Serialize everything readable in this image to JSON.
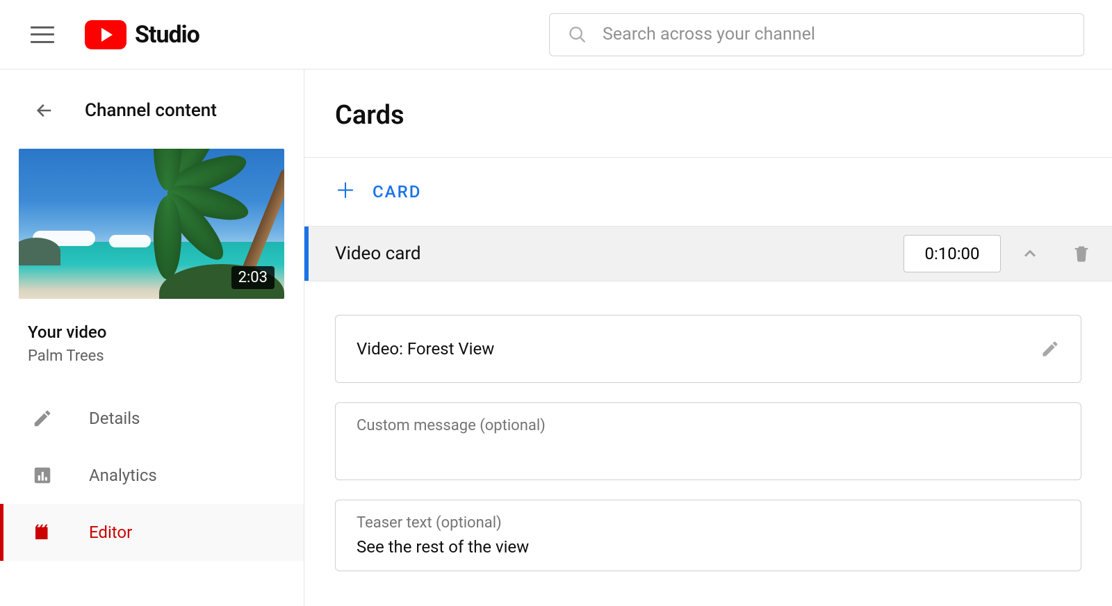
{
  "header": {
    "logo_text": "Studio",
    "search_placeholder": "Search across your channel"
  },
  "sidebar": {
    "back_label": "Channel content",
    "video_duration": "2:03",
    "your_video_label": "Your video",
    "video_title": "Palm Trees",
    "nav": {
      "details": "Details",
      "analytics": "Analytics",
      "editor": "Editor"
    }
  },
  "main": {
    "title": "Cards",
    "add_card_label": "CARD",
    "card": {
      "type_label": "Video card",
      "timestamp": "0:10:00",
      "video_row": "Video: Forest View",
      "custom_message_label": "Custom message (optional)",
      "custom_message_value": "",
      "teaser_label": "Teaser text (optional)",
      "teaser_value": "See the rest of the view"
    }
  }
}
